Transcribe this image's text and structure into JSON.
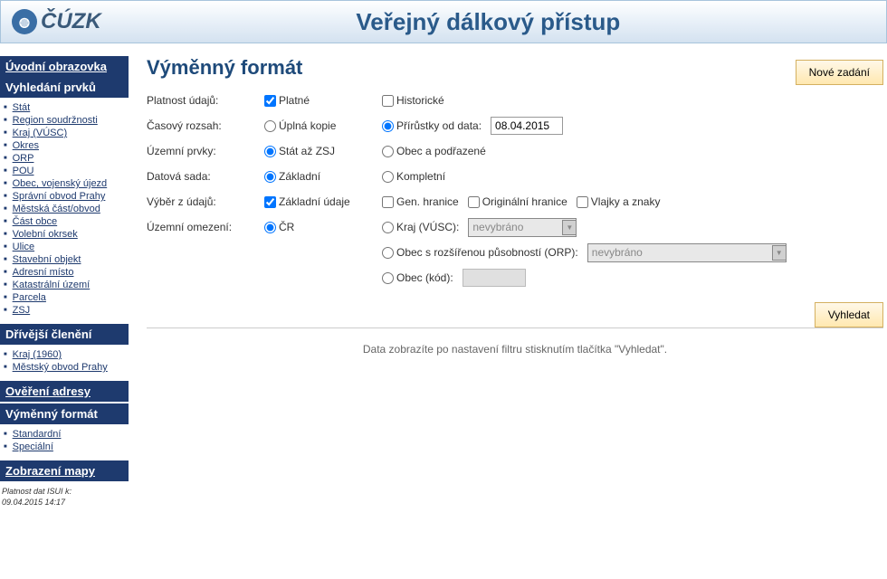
{
  "header": {
    "logo_text": "ČÚZK",
    "title": "Veřejný dálkový přístup"
  },
  "sidebar": {
    "sec1_title": "Úvodní obrazovka",
    "sec2_title": "Vyhledání prvků",
    "items2": [
      "Stát",
      "Region soudržnosti",
      "Kraj (VÚSC)",
      "Okres",
      "ORP",
      "POU",
      "Obec, vojenský újezd",
      "Správní obvod Prahy",
      "Městská část/obvod",
      "Část obce",
      "Volební okrsek",
      "Ulice",
      "Stavební objekt",
      "Adresní místo",
      "Katastrální území",
      "Parcela",
      "ZSJ"
    ],
    "sec3_title": "Dřívější členění",
    "items3": [
      "Kraj (1960)",
      "Městský obvod Prahy"
    ],
    "sec4_title": "Ověření adresy",
    "sec5_title": "Výměnný formát",
    "items5": [
      "Standardní",
      "Speciální"
    ],
    "sec6_title": "Zobrazení mapy",
    "footer1": "Platnost dat ISUI k:",
    "footer2": "09.04.2015 14:17"
  },
  "main": {
    "title": "Výměnný formát",
    "new_btn": "Nové zadání",
    "labels": {
      "platnost": "Platnost údajů:",
      "casovy": "Časový rozsah:",
      "uzemni_prvky": "Územní prvky:",
      "datova_sada": "Datová sada:",
      "vyber": "Výběr z údajů:",
      "uzemni_omezeni": "Územní omezení:"
    },
    "opts": {
      "platne": "Platné",
      "historicke": "Historické",
      "uplna": "Úplná kopie",
      "prirustky": "Přírůstky od data:",
      "date": "08.04.2015",
      "stat_zsj": "Stát až ZSJ",
      "obec_pod": "Obec a podřazené",
      "zakladni": "Základní",
      "kompletni": "Kompletní",
      "zakladni_udaje": "Základní údaje",
      "gen_hranice": "Gen. hranice",
      "orig_hranice": "Originální hranice",
      "vlajky": "Vlajky a znaky",
      "cr": "ČR",
      "kraj_vusc": "Kraj (VÚSC):",
      "orp": "Obec s rozšířenou působností (ORP):",
      "obec_kod": "Obec (kód):",
      "nevybrano": "nevybráno"
    },
    "search_btn": "Vyhledat",
    "hint": "Data zobrazíte po nastavení filtru stisknutím tlačítka \"Vyhledat\"."
  }
}
